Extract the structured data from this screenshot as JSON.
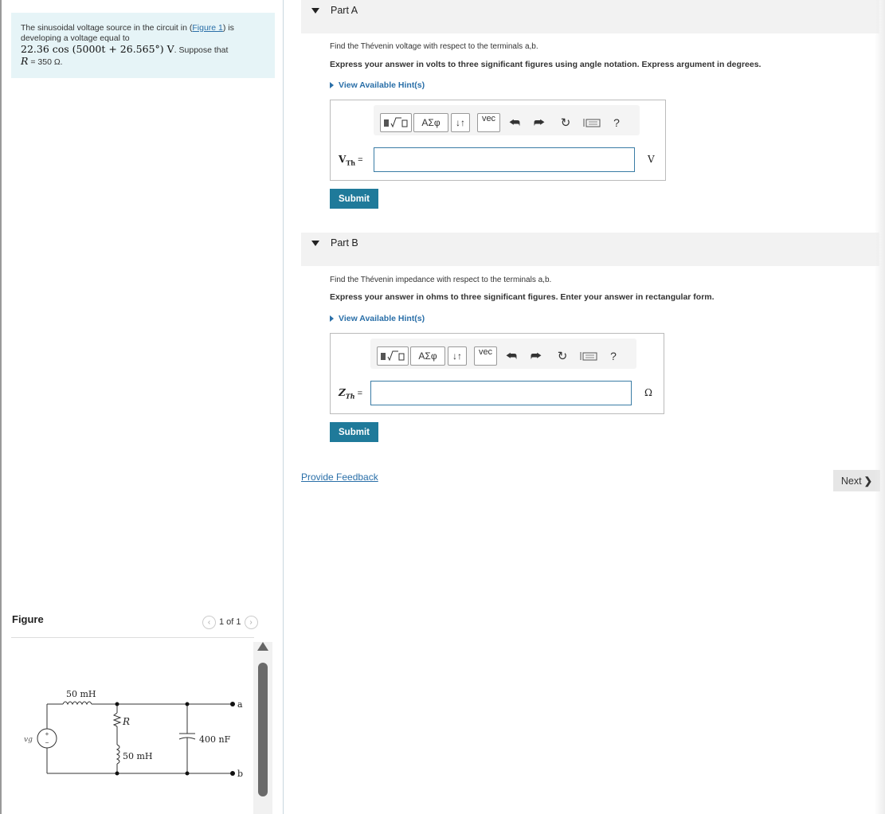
{
  "problem": {
    "text_prefix": "The sinusoidal voltage source in the circuit in (",
    "figure_link": "Figure 1",
    "text_mid": ") is developing a voltage equal to",
    "voltage_expr": "22.36 cos (5000t + 26.565°) V",
    "text_suffix": ". Suppose that",
    "r_label": "R",
    "r_value": " = 350 Ω."
  },
  "figure": {
    "title": "Figure",
    "pager": "1 of 1",
    "labels": {
      "inductor1": "50 mH",
      "resistor": "R",
      "inductor2": "50 mH",
      "capacitor": "400 nF",
      "source": "vg",
      "terminal_a": "a",
      "terminal_b": "b"
    }
  },
  "partA": {
    "header": "Part A",
    "instruction": "Find the Thévenin voltage with respect to the terminals a,b.",
    "instruction_bold": "Express your answer in volts to three significant figures using angle notation. Express argument in degrees.",
    "hint": "View Available Hint(s)",
    "var_main": "V",
    "var_sub": "Th",
    "eq": " =",
    "unit": "V",
    "value": "",
    "submit": "Submit"
  },
  "partB": {
    "header": "Part B",
    "instruction": "Find the Thévenin impedance with respect to the terminals a,b.",
    "instruction_bold": "Express your answer in ohms to three significant figures. Enter your answer in rectangular form.",
    "hint": "View Available Hint(s)",
    "var_main": "Z",
    "var_sub": "Th",
    "eq": " =",
    "unit": "Ω",
    "value": "",
    "submit": "Submit"
  },
  "toolbar": {
    "greek": "ΑΣφ",
    "arrows": "↓↑",
    "vec": "vec",
    "help": "?"
  },
  "footer": {
    "feedback": "Provide Feedback",
    "next": "Next"
  },
  "colors": {
    "accent": "#1f7a9a",
    "link": "#2a6fa8",
    "problem_bg": "#e6f4f7"
  }
}
